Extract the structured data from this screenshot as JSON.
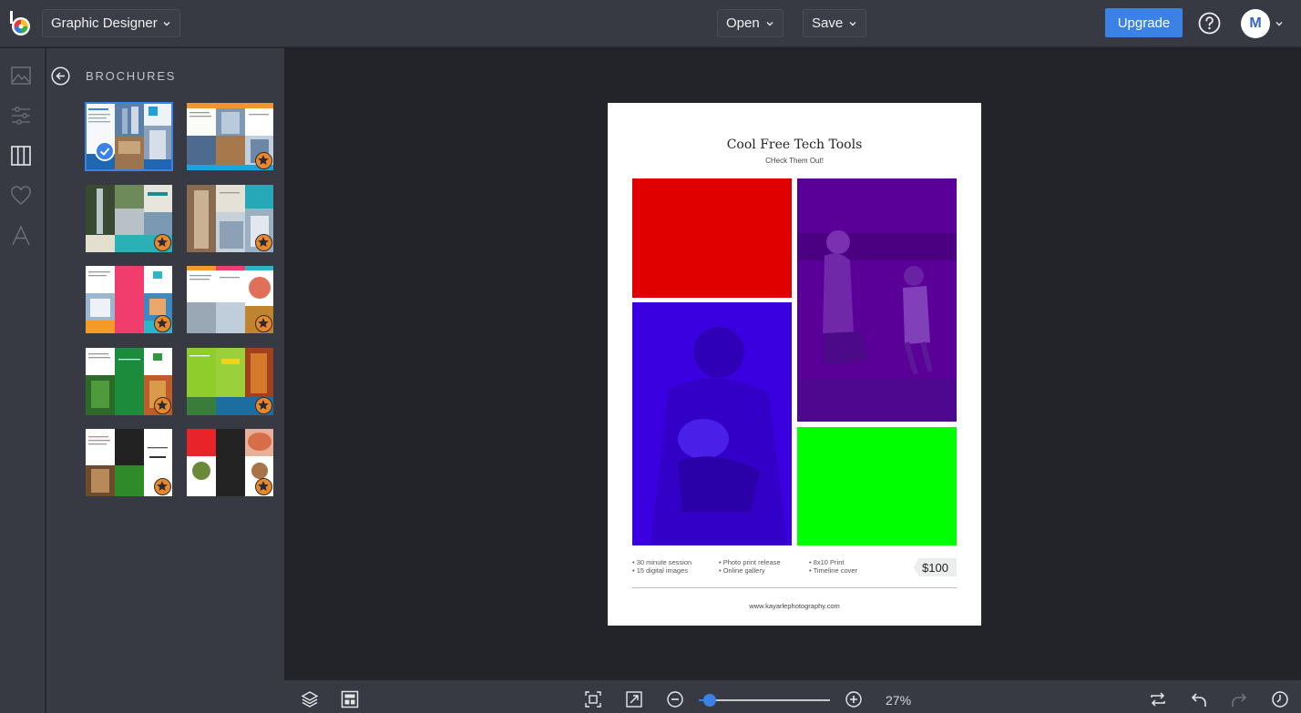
{
  "header": {
    "app_selector": "Graphic Designer",
    "open_label": "Open",
    "save_label": "Save",
    "upgrade_label": "Upgrade",
    "avatar_initial": "M"
  },
  "panel": {
    "title": "BROCHURES"
  },
  "document": {
    "title": "Cool Free Tech Tools",
    "subtitle": "CHeck Them Out!",
    "bullets_col1": [
      "• 30 minute session",
      "• 15 digital images"
    ],
    "bullets_col2": [
      "• Photo print release",
      "• Online gallery"
    ],
    "bullets_col3": [
      "• 8x10 Print",
      "• Timeline cover"
    ],
    "price": "$100",
    "website": "www.kayarlephotography.com"
  },
  "footer": {
    "zoom": "27%",
    "zoom_fraction": 0.08
  },
  "colors": {
    "accent": "#3b82e6",
    "premium": "#e9872b",
    "ph_red": "#e00000",
    "ph_purple": "#5a0098",
    "ph_blue": "#3a00e0",
    "ph_green": "#00ff00"
  }
}
